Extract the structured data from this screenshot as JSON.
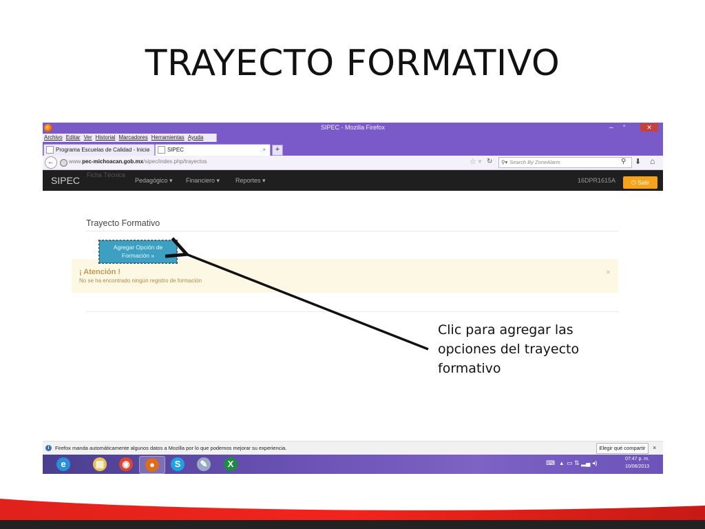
{
  "slide": {
    "title": "TRAYECTO FORMATIVO",
    "callout": "Clic para agregar las opciones del trayecto formativo"
  },
  "browser": {
    "window_title": "SIPEC - Mozilla Firefox",
    "menu": [
      "Archivo",
      "Editar",
      "Ver",
      "Historial",
      "Marcadores",
      "Herramientas",
      "Ayuda"
    ],
    "tabs": [
      {
        "label": "Programa Escuelas de Calidad - Inicio",
        "active": false
      },
      {
        "label": "SIPEC",
        "active": true
      }
    ],
    "new_tab": "+",
    "url_prefix": "www.",
    "url_host": "pec-michoacan.gob.mx",
    "url_path": "/sipec/index.php/trayectos",
    "search_placeholder": "Search By ZoneAlarm"
  },
  "app": {
    "brand": "SIPEC",
    "brand_ghost": "Ficha Técnica",
    "nav": [
      {
        "label": "Pedagógico"
      },
      {
        "label": "Financiero"
      },
      {
        "label": "Reportes"
      }
    ],
    "school_code": "16DPR1615A",
    "logout_label": "Salir"
  },
  "page": {
    "heading": "Trayecto Formativo",
    "add_button_line1": "Agregar Opción de",
    "add_button_line2": "Formación »",
    "alert": {
      "title": "¡ Atención !",
      "message": "No se ha encontrado ningún registro de formación",
      "close": "×"
    }
  },
  "notification": {
    "text": "Firefox manda automáticamente algunos datos a Mozilla por lo que podemos mejorar su experiencia.",
    "button": "Elegir qué compartir",
    "close": "×"
  },
  "taskbar": {
    "apps": [
      {
        "icon": "internet-explorer-icon",
        "glyph": "e",
        "color": "#2a8fd8",
        "active": false
      },
      {
        "icon": "file-explorer-icon",
        "glyph": "▤",
        "color": "#e9c25a",
        "active": false
      },
      {
        "icon": "chrome-icon",
        "glyph": "◉",
        "color": "#e0452f",
        "active": false
      },
      {
        "icon": "firefox-icon",
        "glyph": "●",
        "color": "#e06a1e",
        "active": true
      },
      {
        "icon": "skype-icon",
        "glyph": "S",
        "color": "#1fa2e1",
        "active": false
      },
      {
        "icon": "paint-icon",
        "glyph": "✎",
        "color": "#9aa8c8",
        "active": false
      },
      {
        "icon": "excel-icon",
        "glyph": "X",
        "color": "#1f8a42",
        "active": false
      }
    ],
    "clock_time": "07:47 p. m.",
    "clock_date": "10/06/2013"
  }
}
